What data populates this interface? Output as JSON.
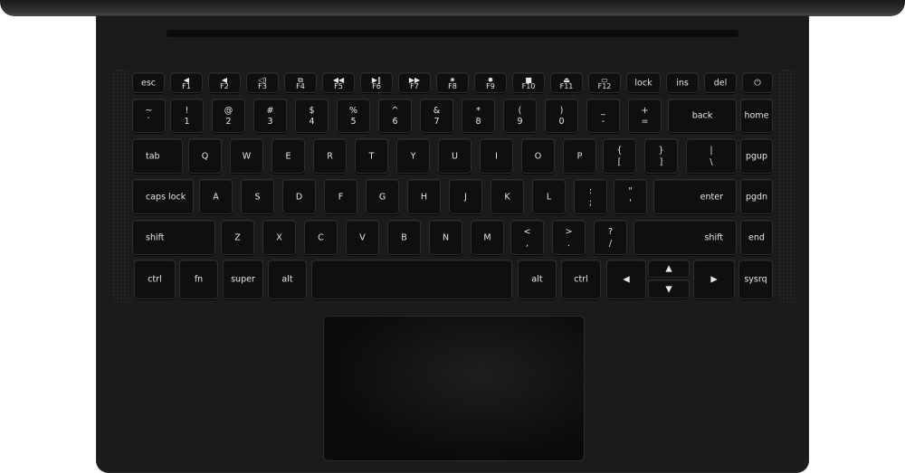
{
  "fn_row": [
    {
      "name": "key-esc",
      "main": "esc"
    },
    {
      "name": "key-f1",
      "icon": "◀",
      "fn": "F1"
    },
    {
      "name": "key-f2",
      "icon": "◀",
      "fn": "F2"
    },
    {
      "name": "key-f3",
      "icon": "◁)",
      "fn": "F3"
    },
    {
      "name": "key-f4",
      "icon": "⧉",
      "fn": "F4"
    },
    {
      "name": "key-f5",
      "icon": "◀◀",
      "fn": "F5"
    },
    {
      "name": "key-f6",
      "icon": "▶‖",
      "fn": "F6"
    },
    {
      "name": "key-f7",
      "icon": "▶▶",
      "fn": "F7"
    },
    {
      "name": "key-f8",
      "icon": "✷",
      "fn": "F8"
    },
    {
      "name": "key-f9",
      "icon": "✸",
      "fn": "F9"
    },
    {
      "name": "key-f10",
      "icon": "■",
      "fn": "F10"
    },
    {
      "name": "key-f11",
      "icon": "⏏",
      "fn": "F11"
    },
    {
      "name": "key-f12",
      "icon": "▭",
      "fn": "F12"
    },
    {
      "name": "key-lock",
      "main": "lock"
    },
    {
      "name": "key-ins",
      "main": "ins"
    },
    {
      "name": "key-del",
      "main": "del"
    },
    {
      "name": "key-power",
      "main": "⏻"
    }
  ],
  "number_row": [
    {
      "name": "key-tilde",
      "up": "~",
      "dn": "`"
    },
    {
      "name": "key-1",
      "up": "!",
      "dn": "1"
    },
    {
      "name": "key-2",
      "up": "@",
      "dn": "2"
    },
    {
      "name": "key-3",
      "up": "#",
      "dn": "3"
    },
    {
      "name": "key-4",
      "up": "$",
      "dn": "4"
    },
    {
      "name": "key-5",
      "up": "%",
      "dn": "5"
    },
    {
      "name": "key-6",
      "up": "^",
      "dn": "6"
    },
    {
      "name": "key-7",
      "up": "&",
      "dn": "7"
    },
    {
      "name": "key-8",
      "up": "*",
      "dn": "8"
    },
    {
      "name": "key-9",
      "up": "(",
      "dn": "9"
    },
    {
      "name": "key-0",
      "up": ")",
      "dn": "0"
    },
    {
      "name": "key-minus",
      "up": "_",
      "dn": "-"
    },
    {
      "name": "key-equals",
      "up": "+",
      "dn": "="
    },
    {
      "name": "key-back",
      "main": "back"
    },
    {
      "name": "key-home",
      "main": "home"
    }
  ],
  "tab_row": [
    {
      "name": "key-tab",
      "main": "tab",
      "align": "l"
    },
    {
      "name": "key-q",
      "main": "Q"
    },
    {
      "name": "key-w",
      "main": "W"
    },
    {
      "name": "key-e",
      "main": "E"
    },
    {
      "name": "key-r",
      "main": "R"
    },
    {
      "name": "key-t",
      "main": "T"
    },
    {
      "name": "key-y",
      "main": "Y"
    },
    {
      "name": "key-u",
      "main": "U"
    },
    {
      "name": "key-i",
      "main": "I"
    },
    {
      "name": "key-o",
      "main": "O"
    },
    {
      "name": "key-p",
      "main": "P"
    },
    {
      "name": "key-lbracket",
      "up": "{",
      "dn": "["
    },
    {
      "name": "key-rbracket",
      "up": "}",
      "dn": "]"
    },
    {
      "name": "key-backslash",
      "up": "|",
      "dn": "\\"
    },
    {
      "name": "key-pgup",
      "main": "pgup"
    }
  ],
  "caps_row": [
    {
      "name": "key-capslock",
      "main": "caps lock",
      "align": "l"
    },
    {
      "name": "key-a",
      "main": "A"
    },
    {
      "name": "key-s",
      "main": "S"
    },
    {
      "name": "key-d",
      "main": "D"
    },
    {
      "name": "key-f",
      "main": "F"
    },
    {
      "name": "key-g",
      "main": "G"
    },
    {
      "name": "key-h",
      "main": "H"
    },
    {
      "name": "key-j",
      "main": "J"
    },
    {
      "name": "key-k",
      "main": "K"
    },
    {
      "name": "key-l",
      "main": "L"
    },
    {
      "name": "key-semicolon",
      "up": ":",
      "dn": ";"
    },
    {
      "name": "key-quote",
      "up": "\"",
      "dn": "'"
    },
    {
      "name": "key-enter",
      "main": "enter",
      "align": "r"
    },
    {
      "name": "key-pgdn",
      "main": "pgdn"
    }
  ],
  "shift_row": [
    {
      "name": "key-lshift",
      "main": "shift",
      "align": "l"
    },
    {
      "name": "key-z",
      "main": "Z"
    },
    {
      "name": "key-x",
      "main": "X"
    },
    {
      "name": "key-c",
      "main": "C"
    },
    {
      "name": "key-v",
      "main": "V"
    },
    {
      "name": "key-b",
      "main": "B"
    },
    {
      "name": "key-n",
      "main": "N"
    },
    {
      "name": "key-m",
      "main": "M"
    },
    {
      "name": "key-comma",
      "up": "<",
      "dn": ","
    },
    {
      "name": "key-period",
      "up": ">",
      "dn": "."
    },
    {
      "name": "key-slash",
      "up": "?",
      "dn": "/"
    },
    {
      "name": "key-rshift",
      "main": "shift",
      "align": "r"
    },
    {
      "name": "key-end",
      "main": "end"
    }
  ],
  "bottom_row": [
    {
      "name": "key-lctrl",
      "main": "ctrl"
    },
    {
      "name": "key-fn",
      "main": "fn"
    },
    {
      "name": "key-super",
      "main": "super"
    },
    {
      "name": "key-lalt",
      "main": "alt"
    },
    {
      "name": "key-space",
      "main": ""
    },
    {
      "name": "key-ralt",
      "main": "alt"
    },
    {
      "name": "key-rctrl",
      "main": "ctrl"
    },
    {
      "name": "key-left",
      "main": "◀"
    },
    {
      "name": "key-up",
      "main": "▲"
    },
    {
      "name": "key-down",
      "main": "▼"
    },
    {
      "name": "key-right",
      "main": "▶"
    },
    {
      "name": "key-sysrq",
      "main": "sysrq"
    }
  ]
}
